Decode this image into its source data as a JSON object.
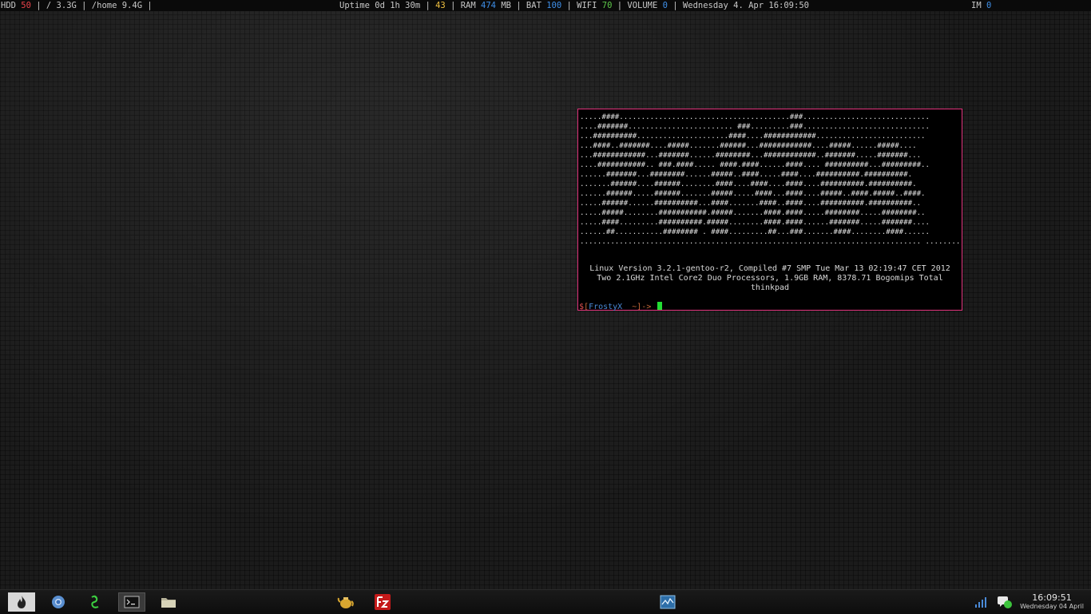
{
  "topbar": {
    "hdd_label": "HDD ",
    "hdd_value": "50",
    "disk_text": " | / 3.3G | /home 9.4G |",
    "uptime_text": "Uptime 0d 1h 30m | ",
    "load_value": "43",
    "ram_label": " | RAM ",
    "ram_value": "474",
    "ram_unit": " MB | BAT ",
    "bat_value": "100",
    "wifi_label": " | WIFI ",
    "wifi_value": "70",
    "volume_label": " | VOLUME ",
    "volume_value": "0",
    "datetime_text": " | Wednesday  4. Apr 16:09:50",
    "im_label": "IM ",
    "im_value": "0"
  },
  "terminal": {
    "ascii_art": ".....####.......................................###.............................\n....#######........................ ###.........###.............................\n...##########.....................####....############.........................\n...####..#######....#####.......######...############....#####......#####....\n...############...#######......########...############..#######.....#######...\n....###########.. ###.####..... ####.####......####.... ##########...#########..\n......#######...########......#####..####.....####....##########.##########.\n.......######....######........####....####....####....##########.##########.\n......######.....######.......#####.....####...####....#####..####.#####..####.\n.....######......##########...####.......####..####....##########.##########..\n.....#####........###########.#####.......####.####.....########.....########..\n.....####.........##########.#####........####.####......#######.....#######....\n......##...........######## . ####.........##...###.......####........####......\n.............................................................................. ..........",
    "sysinfo": [
      "Linux Version 3.2.1-gentoo-r2, Compiled #7 SMP Tue Mar 13 02:19:47 CET 2012",
      "Two 2.1GHz Intel Core2 Duo Processors, 1.9GB RAM, 8378.71 Bogomips Total",
      "thinkpad"
    ],
    "prompt": {
      "dollar": "$",
      "open": "[",
      "user": "FrostyX",
      "path": "  ~",
      "close_arrow": "]-> "
    }
  },
  "taskbar": {
    "launchers": [
      "fire-icon",
      "chromium-icon",
      "python-icon",
      "terminal-icon",
      "folder-icon"
    ],
    "clock_time": "16:09:51",
    "clock_date": "Wednesday 04 April"
  }
}
